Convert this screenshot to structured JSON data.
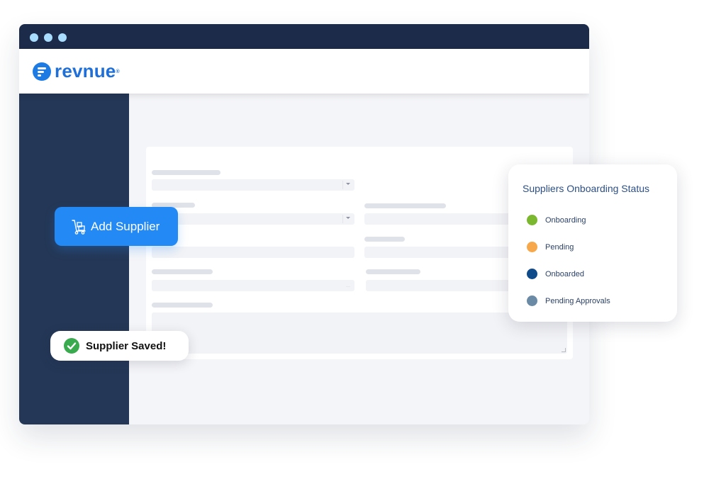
{
  "brand": {
    "name": "revnue",
    "mark": "®",
    "color": "#1e6fd8"
  },
  "window": {
    "titlebar_color": "#1c2b4a",
    "sidebar_color": "#243756",
    "dot_color": "#a8ddff"
  },
  "actions": {
    "add_supplier": {
      "label": "Add Supplier",
      "icon": "hand-truck-icon",
      "color": "#2289f5"
    }
  },
  "toast": {
    "label": "Supplier Saved!",
    "icon": "check-circle-icon",
    "icon_color": "#3aaa4e"
  },
  "status_panel": {
    "title": "Suppliers Onboarding Status",
    "items": [
      {
        "label": "Onboarding",
        "color": "#7cb82f"
      },
      {
        "label": "Pending",
        "color": "#f7a84a"
      },
      {
        "label": "Onboarded",
        "color": "#0f4a8a"
      },
      {
        "label": "Pending Approvals",
        "color": "#6a8aa6"
      }
    ]
  }
}
